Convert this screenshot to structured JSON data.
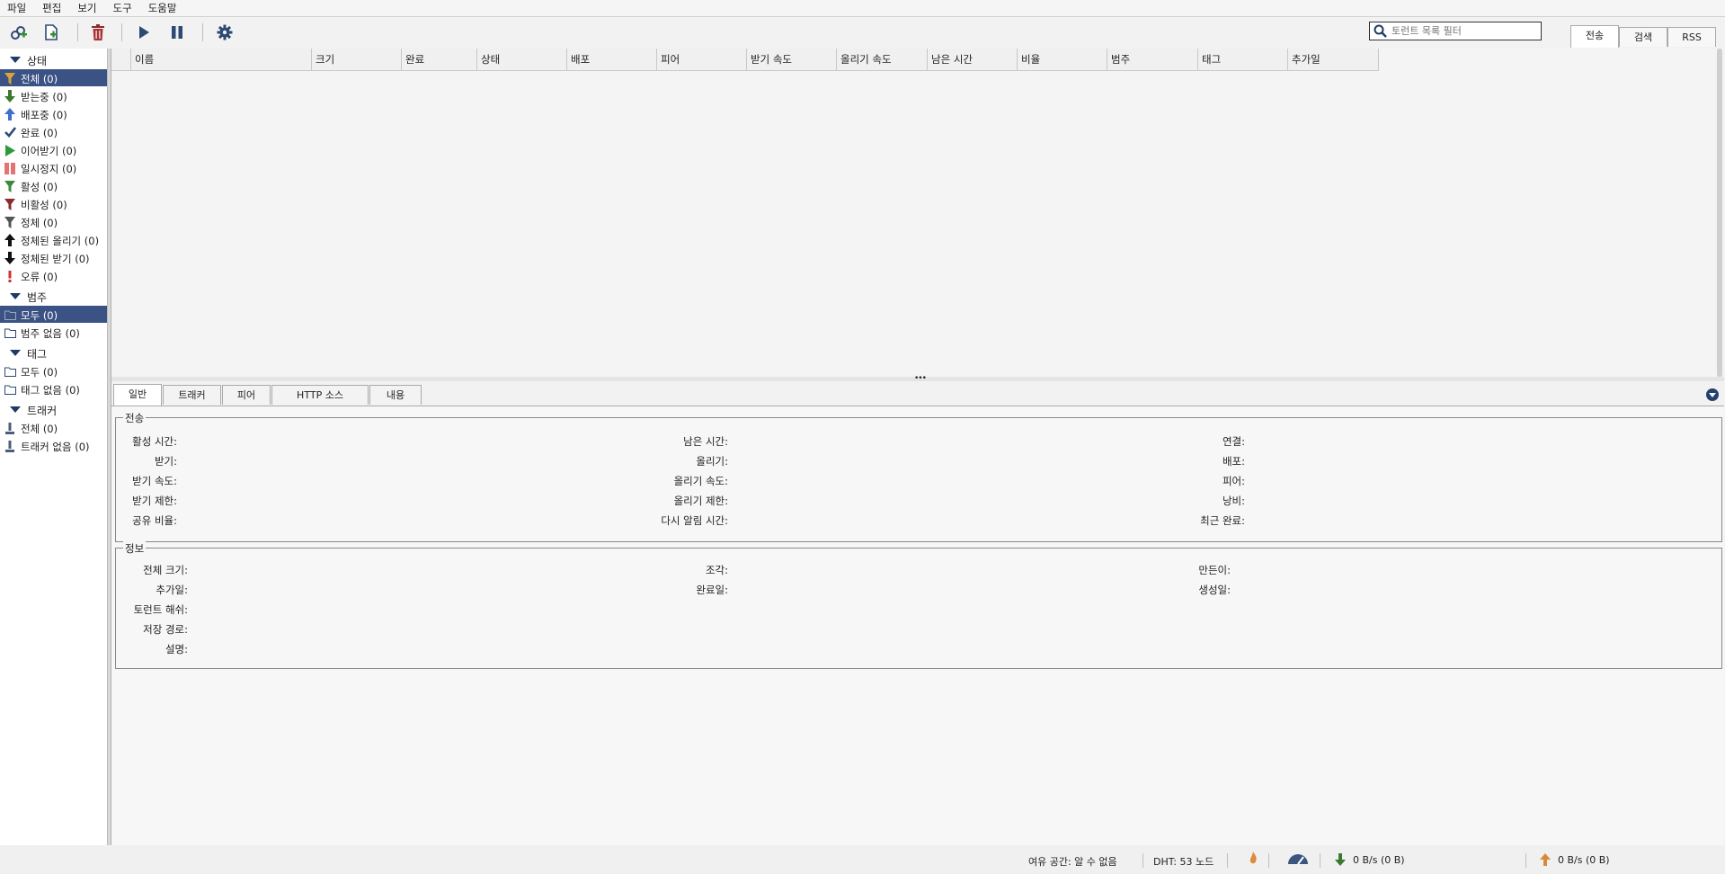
{
  "menu": [
    "파일",
    "편집",
    "보기",
    "도구",
    "도움말"
  ],
  "toolbar": {
    "search_placeholder": "토런트 목록 필터",
    "right_tabs": [
      "전송",
      "검색",
      "RSS"
    ]
  },
  "sidebar": {
    "status_header": "상태",
    "status_items": [
      {
        "label": "전체 (0)",
        "icon": "filter-all-icon"
      },
      {
        "label": "받는중 (0)",
        "icon": "arrow-down-icon"
      },
      {
        "label": "배포중 (0)",
        "icon": "arrow-up-icon"
      },
      {
        "label": "완료 (0)",
        "icon": "checkmark-icon"
      },
      {
        "label": "이어받기 (0)",
        "icon": "play-icon"
      },
      {
        "label": "일시정지 (0)",
        "icon": "pause-icon"
      },
      {
        "label": "활성 (0)",
        "icon": "filter-active-icon"
      },
      {
        "label": "비활성 (0)",
        "icon": "filter-inactive-icon"
      },
      {
        "label": "정체 (0)",
        "icon": "filter-stalled-icon"
      },
      {
        "label": "정체된 올리기 (0)",
        "icon": "arrow-up-black-icon"
      },
      {
        "label": "정체된 받기 (0)",
        "icon": "arrow-down-black-icon"
      },
      {
        "label": "오류 (0)",
        "icon": "error-icon"
      }
    ],
    "category_header": "범주",
    "category_items": [
      {
        "label": "모두 (0)",
        "icon": "folder-icon"
      },
      {
        "label": "범주 없음 (0)",
        "icon": "folder-icon"
      }
    ],
    "tag_header": "태그",
    "tag_items": [
      {
        "label": "모두 (0)",
        "icon": "folder-icon"
      },
      {
        "label": "태그 없음 (0)",
        "icon": "folder-icon"
      }
    ],
    "tracker_header": "트래커",
    "tracker_items": [
      {
        "label": "전체 (0)",
        "icon": "tracker-icon"
      },
      {
        "label": "트래커 없음 (0)",
        "icon": "tracker-icon"
      }
    ]
  },
  "table": {
    "columns": [
      "이름",
      "크기",
      "완료",
      "상태",
      "배포",
      "피어",
      "받기 속도",
      "올리기 속도",
      "남은 시간",
      "비율",
      "범주",
      "태그",
      "추가일"
    ]
  },
  "bottom_tabs": [
    "일반",
    "트래커",
    "피어",
    "HTTP 소스",
    "내용"
  ],
  "transfer": {
    "title": "전송",
    "col1": [
      "활성 시간:",
      "받기:",
      "받기 속도:",
      "받기 제한:",
      "공유 비율:"
    ],
    "col2": [
      "남은 시간:",
      "올리기:",
      "올리기 속도:",
      "올리기 제한:",
      "다시 알림 시간:"
    ],
    "col3": [
      "연결:",
      "배포:",
      "피어:",
      "낭비:",
      "최근 완료:"
    ]
  },
  "info": {
    "title": "정보",
    "col1": [
      "전체 크기:",
      "추가일:",
      "토런트 해쉬:",
      "저장 경로:",
      "설명:"
    ],
    "col2": [
      "조각:",
      "완료일:"
    ],
    "col3": [
      "만든이:",
      "생성일:"
    ]
  },
  "statusbar": {
    "free_space": "여유 공간: 알 수 없음",
    "dht": "DHT: 53 노드",
    "download": "0 B/s (0 B)",
    "upload": "0 B/s (0 B)"
  },
  "colors": {
    "selection": "#3b5285",
    "accent": "#24406e"
  }
}
